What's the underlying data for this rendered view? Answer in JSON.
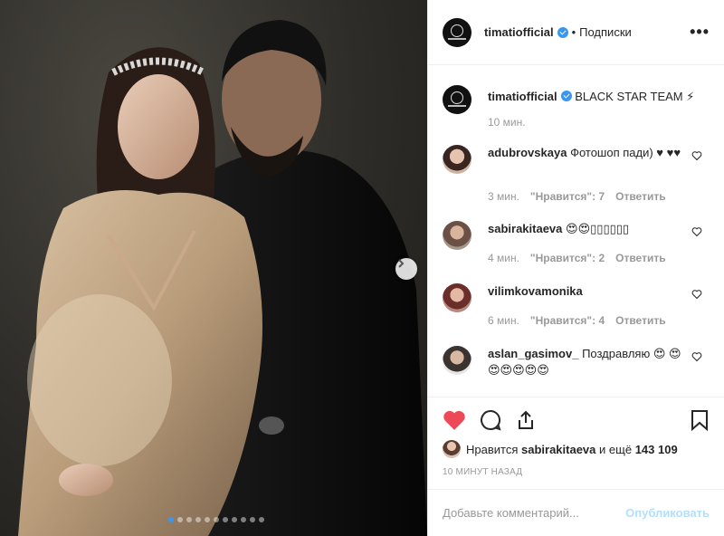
{
  "post": {
    "carousel": {
      "slide_count": 11,
      "active_slide": 1
    },
    "header": {
      "username": "timatiofficial",
      "separator": "•",
      "follow_label": "Подписки",
      "more_label": "•••"
    },
    "caption": {
      "username": "timatiofficial",
      "text": "BLACK STAR TEAM ⚡",
      "time": "10 мин."
    },
    "comments": [
      {
        "username": "adubrovskaya",
        "text": "Фотошоп пади) ♥ ♥♥",
        "time": "3 мин.",
        "likes": "\"Нравится\": 7",
        "reply": "Ответить"
      },
      {
        "username": "sabirakitaeva",
        "text": "😍😍▯▯▯▯▯▯",
        "time": "4 мин.",
        "likes": "\"Нравится\": 2",
        "reply": "Ответить"
      },
      {
        "username": "vilimkovamonika",
        "text": "",
        "time": "6 мин.",
        "likes": "\"Нравится\": 4",
        "reply": "Ответить"
      },
      {
        "username": "aslan_gasimov_",
        "text": "Поздравляю 😍 😍😍😍😍😍😍",
        "time": "",
        "likes": "",
        "reply": ""
      }
    ],
    "likes": {
      "prefix": "Нравится",
      "user": "sabirakitaeva",
      "middle": "и ещё",
      "count": "143 109"
    },
    "post_time": "10 МИНУТ НАЗАД",
    "add_comment": {
      "placeholder": "Добавьте комментарий...",
      "publish_label": "Опубликовать"
    },
    "icons": {
      "like": "heart-filled-icon",
      "comment": "comment-bubble-icon",
      "share": "share-icon",
      "save": "bookmark-icon",
      "next": "chevron-right-icon"
    },
    "colors": {
      "like": "#ed4956",
      "verified": "#3897f0",
      "publish_disabled": "#b2dffc",
      "meta_text": "#999999"
    }
  }
}
